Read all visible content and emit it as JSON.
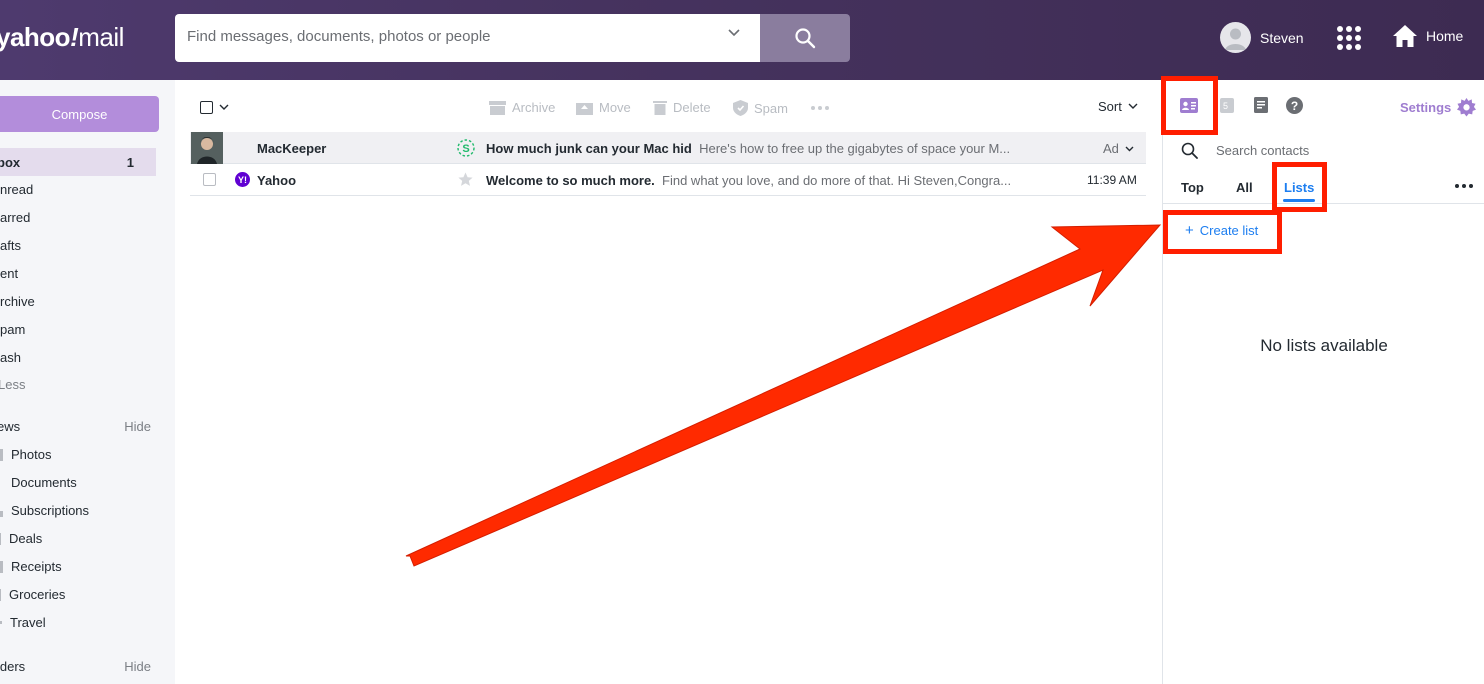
{
  "header": {
    "logo_prefix": "yahoo",
    "logo_slash": "!",
    "logo_suffix": "mail",
    "search_placeholder": "Find messages, documents, photos or people",
    "user_name": "Steven",
    "home_label": "Home"
  },
  "sidebar": {
    "compose_label": "Compose",
    "inbox": {
      "label": "box",
      "count": "1"
    },
    "folders": [
      "nread",
      "arred",
      "afts",
      "ent",
      "rchive",
      "pam",
      "ash"
    ],
    "less_label": "Less",
    "views": {
      "label": "ews",
      "hide": "Hide",
      "items": [
        "Photos",
        "Documents",
        "Subscriptions",
        "Deals",
        "Receipts",
        "Groceries",
        "Travel"
      ]
    },
    "folders_section": {
      "label": "lders",
      "hide": "Hide"
    }
  },
  "toolbar": {
    "archive": "Archive",
    "move": "Move",
    "delete": "Delete",
    "spam": "Spam",
    "sort": "Sort"
  },
  "messages": [
    {
      "sender": "MacKeeper",
      "subject": "How much junk can your Mac hid",
      "snippet": "Here's how to free up the gigabytes of space your M...",
      "meta": "Ad",
      "is_ad": true
    },
    {
      "sender": "Yahoo",
      "subject": "Welcome to so much more.",
      "snippet": "Find what you love, and do more of that. Hi Steven,Congra...",
      "meta": "11:39 AM",
      "is_ad": false
    }
  ],
  "right_panel": {
    "settings_label": "Settings",
    "calendar_day": "5",
    "search_placeholder": "Search contacts",
    "tabs": [
      "Top",
      "All",
      "Lists"
    ],
    "active_tab": "Lists",
    "create_list": "Create list",
    "create_plus": "+",
    "empty_message": "No lists available"
  },
  "colors": {
    "header_bg": "#46335f",
    "compose": "#b38ddb",
    "accent_blue": "#1d7ef0",
    "settings_purple": "#9f7dd0",
    "highlight_red": "#ff1e00"
  }
}
